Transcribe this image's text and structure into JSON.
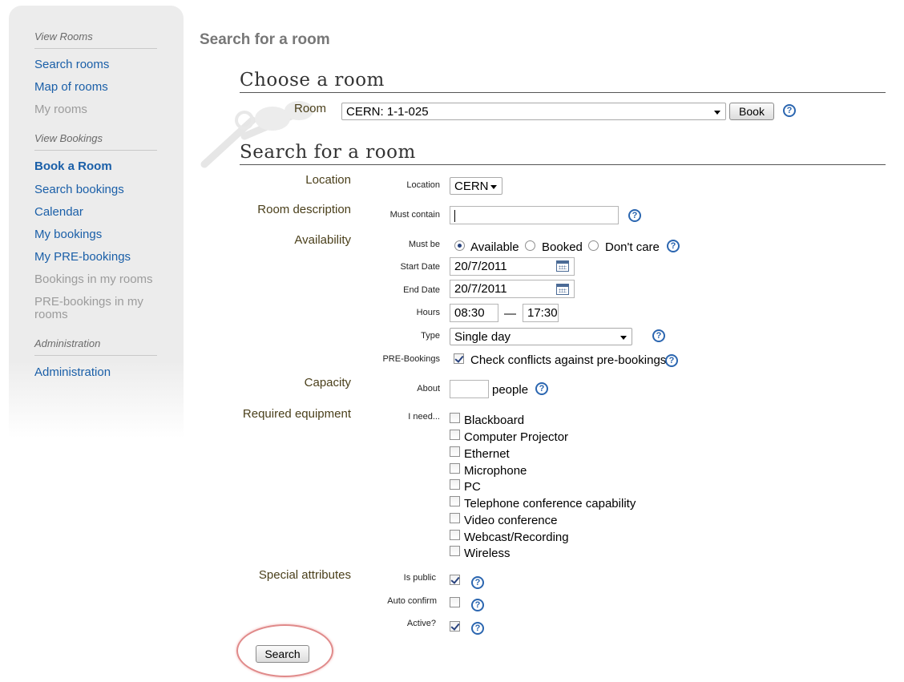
{
  "sidebar": {
    "section_view_rooms": "View Rooms",
    "search_rooms": "Search rooms",
    "map_of_rooms": "Map of rooms",
    "my_rooms": "My rooms",
    "section_view_bookings": "View Bookings",
    "book_a_room": "Book a Room",
    "search_bookings": "Search bookings",
    "calendar": "Calendar",
    "my_bookings": "My bookings",
    "my_pre_bookings": "My PRE-bookings",
    "bookings_in_my_rooms": "Bookings in my rooms",
    "pre_bookings_in_my_rooms_1": "PRE-bookings in my",
    "pre_bookings_in_my_rooms_2": "rooms",
    "section_administration": "Administration",
    "administration": "Administration"
  },
  "page_title": "Search for a room",
  "choose_room": {
    "heading": "Choose a room",
    "room_label": "Room",
    "room_value": "CERN:   1-1-025",
    "book_button": "Book"
  },
  "search": {
    "heading": "Search for a room",
    "location_group": "Location",
    "location_label": "Location",
    "location_value": "CERN",
    "room_description_group": "Room description",
    "must_contain_label": "Must contain",
    "must_contain_value": "",
    "availability_group": "Availability",
    "must_be_label": "Must be",
    "available": "Available",
    "booked": "Booked",
    "dont_care": "Don't care",
    "start_date_label": "Start Date",
    "start_date_value": "20/7/2011",
    "end_date_label": "End Date",
    "end_date_value": "20/7/2011",
    "hours_label": "Hours",
    "hours_from": "08:30",
    "hours_sep": "—",
    "hours_to": "17:30",
    "type_label": "Type",
    "type_value": "Single day",
    "pre_bookings_label": "PRE-Bookings",
    "pre_bookings_text": "Check conflicts against pre-bookings",
    "capacity_group": "Capacity",
    "about_label": "About",
    "about_value": "",
    "people": "people",
    "equipment_group": "Required equipment",
    "i_need_label": "I need...",
    "equipment": [
      "Blackboard",
      "Computer Projector",
      "Ethernet",
      "Microphone",
      "PC",
      "Telephone conference capability",
      "Video conference",
      "Webcast/Recording",
      "Wireless"
    ],
    "special_group": "Special attributes",
    "is_public_label": "Is public",
    "auto_confirm_label": "Auto confirm",
    "active_label": "Active?",
    "search_button": "Search"
  },
  "state": {
    "must_be_selected": "Available",
    "pre_bookings_checked": true,
    "is_public_checked": true,
    "auto_confirm_checked": false,
    "active_checked": true
  },
  "colors": {
    "link": "#1a5fa8",
    "disabled_link": "#9c9c9c",
    "group_label": "#4a3f1a",
    "help_icon": "#2b66b0",
    "highlight": "#e08a8a"
  }
}
